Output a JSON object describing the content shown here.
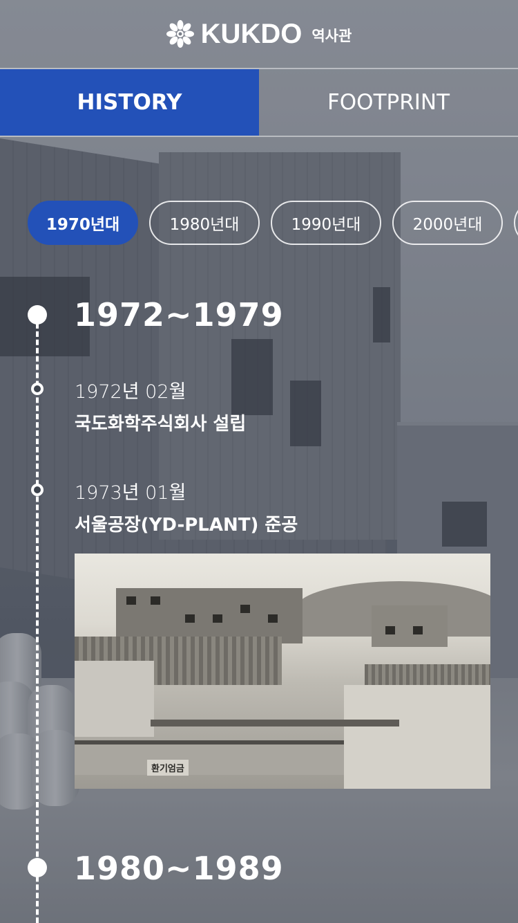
{
  "header": {
    "brand": "KUKDO",
    "sub_title": "역사관",
    "logo_icon": "kukdo-flower-logo"
  },
  "tabs": [
    {
      "label": "HISTORY",
      "active": true
    },
    {
      "label": "FOOTPRINT",
      "active": false
    }
  ],
  "decades": [
    {
      "label": "1970년대",
      "active": true
    },
    {
      "label": "1980년대",
      "active": false
    },
    {
      "label": "1990년대",
      "active": false
    },
    {
      "label": "2000년대",
      "active": false
    },
    {
      "label": "",
      "active": false
    }
  ],
  "timeline": {
    "periods": [
      {
        "range": "1972~1979",
        "events": [
          {
            "date": "1972년 02월",
            "title": "국도화학주식회사 설립"
          },
          {
            "date": "1973년 01월",
            "title": "서울공장(YD-PLANT) 준공"
          }
        ],
        "photo": {
          "sign_text": "환기엄금"
        }
      },
      {
        "range": "1980~1989",
        "events": []
      }
    ]
  },
  "colors": {
    "accent": "#2351b8",
    "text": "#ffffff"
  }
}
